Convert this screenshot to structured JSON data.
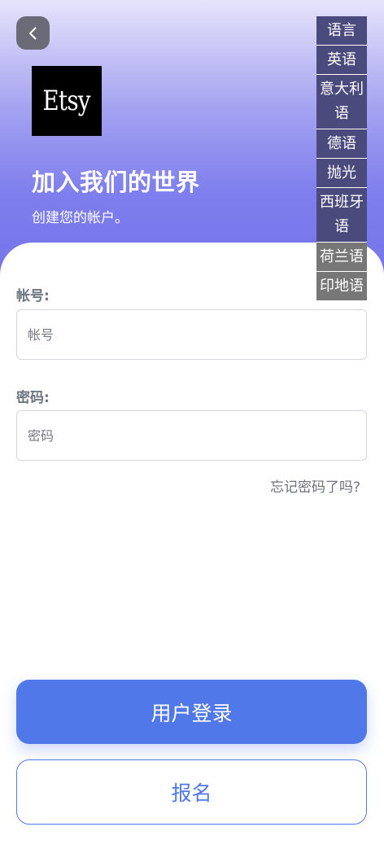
{
  "header": {
    "logo_text": "Etsy",
    "title": "加入我们的世界",
    "subtitle": "创建您的帐户。"
  },
  "language_menu": {
    "title": "语言",
    "items": [
      "英语",
      "意大利语",
      "德语",
      "抛光",
      "西班牙语",
      "荷兰语",
      "印地语"
    ]
  },
  "form": {
    "account_label": "帐号:",
    "account_placeholder": "帐号",
    "account_value": "",
    "password_label": "密码:",
    "password_placeholder": "密码",
    "password_value": "",
    "forgot_link": "忘记密码了吗?"
  },
  "actions": {
    "login_label": "用户登录",
    "signup_label": "报名"
  },
  "colors": {
    "accent": "#5178e8",
    "lang_menu_bg": "#4a4a7d",
    "lang_menu_bg_muted": "#777777"
  },
  "icons": {
    "back": "chevron-left-icon"
  }
}
